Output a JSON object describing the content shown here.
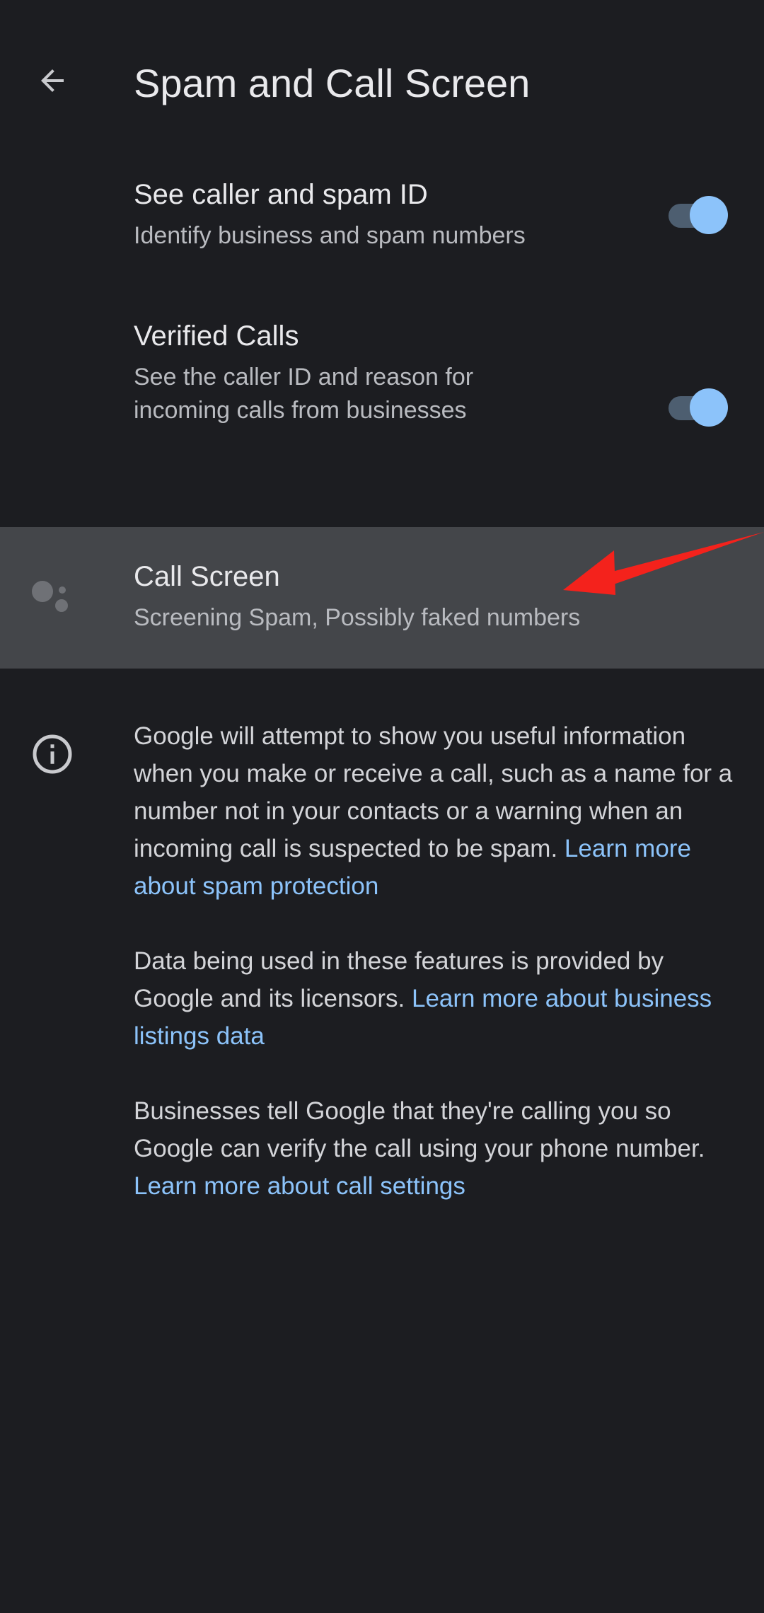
{
  "header": {
    "title": "Spam and Call Screen",
    "back_icon": "arrow-back-icon"
  },
  "settings": {
    "caller_spam_id": {
      "title": "See caller and spam ID",
      "subtitle": "Identify business and spam numbers",
      "enabled": true
    },
    "verified_calls": {
      "title": "Verified Calls",
      "subtitle": "See the caller ID and reason for incoming calls from businesses",
      "enabled": true
    },
    "call_screen": {
      "title": "Call Screen",
      "subtitle": "Screening Spam, Possibly faked numbers",
      "icon": "google-assistant-icon"
    }
  },
  "info": {
    "icon": "info-icon",
    "para1_text": "Google will attempt to show you useful information when you make or receive a call, such as a name for a number not in your contacts or a warning when an incoming call is suspected to be spam.",
    "para1_link": "Learn more about spam protection",
    "para2_text": "Data being used in these features is provided by Google and its licensors.",
    "para2_link": "Learn more about business listings data",
    "para3_text": "Businesses tell Google that they're calling you so Google can verify the call using your phone number.",
    "para3_link": "Learn more about call settings"
  },
  "colors": {
    "background": "#1c1d21",
    "highlight_row": "#44464a",
    "accent": "#8cc3fa",
    "toggle_track": "#4d5e70",
    "annotation_arrow": "#f4221c"
  }
}
